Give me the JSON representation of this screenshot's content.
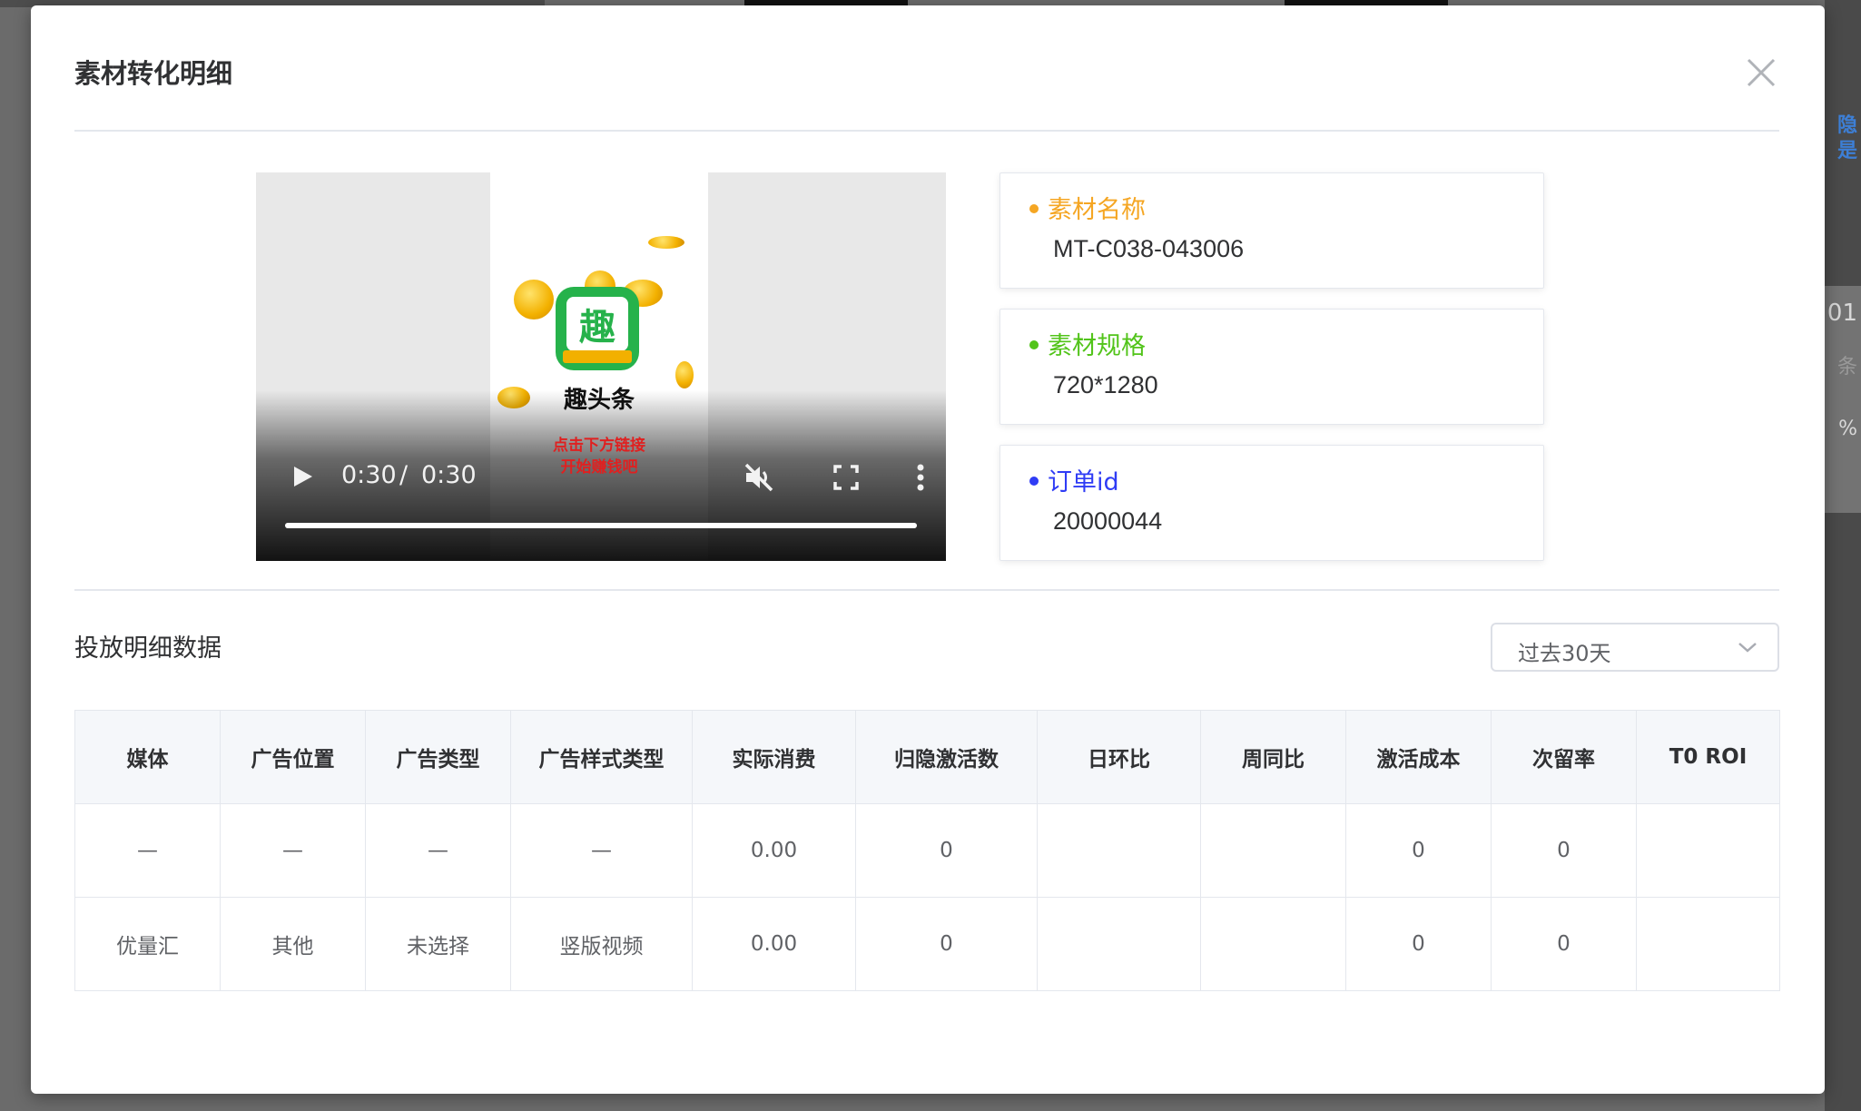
{
  "dialog": {
    "title": "素材转化明细"
  },
  "background": {
    "right_texts": [
      "隐",
      "是",
      "01",
      "条",
      "%"
    ]
  },
  "video": {
    "app_name": "趣头条",
    "icon_char": "趣",
    "promo_line1": "点击下方链接",
    "promo_line2": "开始赚钱吧",
    "time_current": "0:30",
    "time_separator": "/",
    "time_total": "0:30",
    "progress": 1.0
  },
  "info": {
    "name": {
      "label": "素材名称",
      "value": "MT-C038-043006",
      "color": "#f5a623"
    },
    "spec": {
      "label": "素材规格",
      "value": "720*1280",
      "color": "#52c41a"
    },
    "order": {
      "label": "订单id",
      "value": "20000044",
      "color": "#2f3cf5"
    }
  },
  "section": {
    "title": "投放明细数据",
    "range_select": "过去30天"
  },
  "table": {
    "columns": [
      "媒体",
      "广告位置",
      "广告类型",
      "广告样式类型",
      "实际消费",
      "归隐激活数",
      "日环比",
      "周同比",
      "激活成本",
      "次留率",
      "T0 ROI"
    ],
    "rows": [
      [
        "—",
        "—",
        "—",
        "—",
        "0.00",
        "0",
        "",
        "",
        "0",
        "0",
        ""
      ],
      [
        "优量汇",
        "其他",
        "未选择",
        "竖版视频",
        "0.00",
        "0",
        "",
        "",
        "0",
        "0",
        ""
      ]
    ]
  }
}
